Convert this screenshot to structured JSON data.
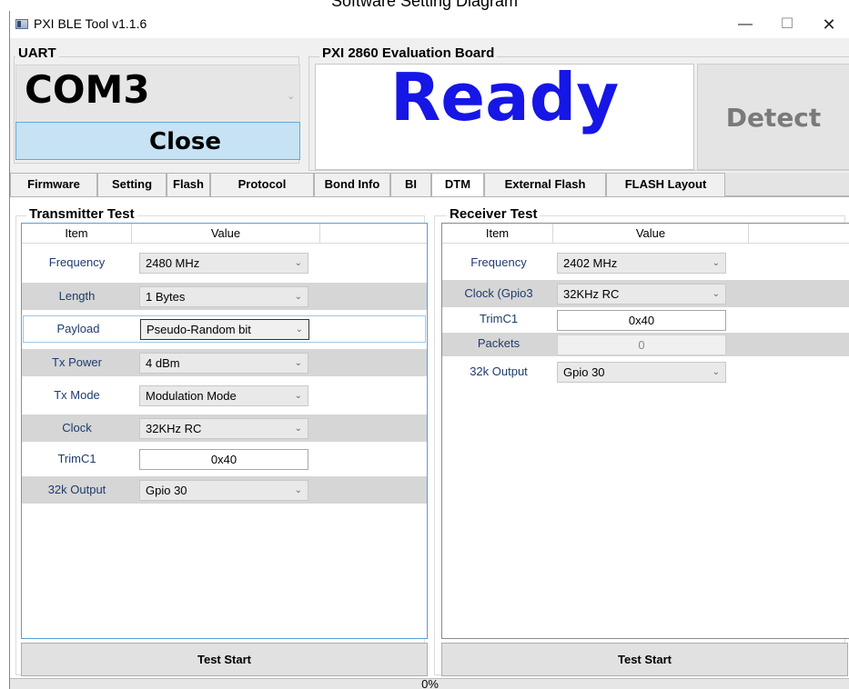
{
  "caption": "Software Setting Diagram",
  "window": {
    "title": "PXI BLE Tool v1.1.6",
    "controls": {
      "minimize": "—",
      "maximize": "☐",
      "close": "✕"
    }
  },
  "uart": {
    "group_title": "UART",
    "port_value": "COM3",
    "close_label": "Close"
  },
  "board": {
    "group_title": "PXI 2860 Evaluation Board",
    "status_text": "Ready",
    "detect_label": "Detect"
  },
  "tabs": [
    {
      "label": "Firmware"
    },
    {
      "label": "Setting"
    },
    {
      "label": "Flash"
    },
    {
      "label": "Protocol"
    },
    {
      "label": "Bond Info"
    },
    {
      "label": "BI"
    },
    {
      "label": "DTM"
    },
    {
      "label": "External Flash"
    },
    {
      "label": "FLASH Layout"
    }
  ],
  "active_tab": "DTM",
  "transmitter": {
    "title": "Transmitter Test",
    "col_item": "Item",
    "col_value": "Value",
    "rows": [
      {
        "label": "Frequency",
        "value": "2480 MHz"
      },
      {
        "label": "Length",
        "value": "1 Bytes"
      },
      {
        "label": "Payload",
        "value": "Pseudo-Random bit"
      },
      {
        "label": "Tx Power",
        "value": "4 dBm"
      },
      {
        "label": "Tx Mode",
        "value": "Modulation Mode"
      },
      {
        "label": "Clock",
        "value": "32KHz RC"
      },
      {
        "label": "TrimC1",
        "value": "0x40"
      },
      {
        "label": "32k Output",
        "value": "Gpio 30"
      }
    ],
    "start_label": "Test Start"
  },
  "receiver": {
    "title": "Receiver Test",
    "col_item": "Item",
    "col_value": "Value",
    "rows": [
      {
        "label": "Frequency",
        "value": "2402 MHz"
      },
      {
        "label": "Clock (Gpio3",
        "value": "32KHz RC"
      },
      {
        "label": "TrimC1",
        "value": "0x40"
      },
      {
        "label": "Packets",
        "value": "0"
      },
      {
        "label": "32k Output",
        "value": "Gpio 30"
      }
    ],
    "start_label": "Test Start"
  },
  "status": {
    "progress": "0%"
  },
  "icons": {
    "dropdown": "chevron-down-icon",
    "app": "app-window-icon"
  },
  "colors": {
    "ready_text": "#1616e6",
    "close_button_bg": "#c6e2f3",
    "detect_text": "#7a7a7a"
  }
}
